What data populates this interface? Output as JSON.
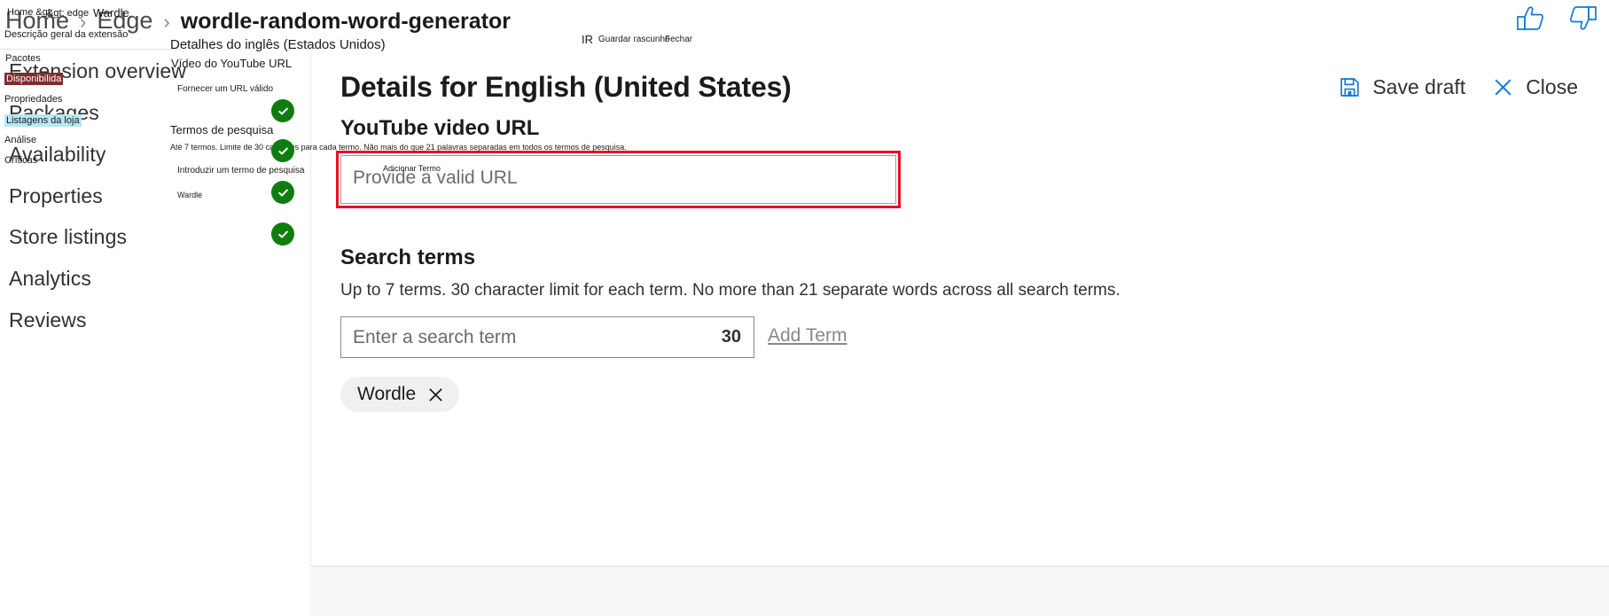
{
  "breadcrumb": {
    "items": [
      {
        "label": "Home",
        "kind": "link"
      },
      {
        "label": "Edge",
        "kind": "link"
      },
      {
        "label": "wordle-random-word-generator",
        "kind": "current"
      }
    ],
    "separator": "›",
    "overlay": [
      {
        "text": "Home &gt;"
      },
      {
        "text": "&gt; edge"
      },
      {
        "text": "Wardle"
      }
    ]
  },
  "topicons": {
    "thumbs_up": "thumbs-up-icon",
    "thumbs_down": "thumbs-down-icon"
  },
  "sidebar": {
    "items": [
      {
        "label": "Extension overview",
        "overlay": "Pacotes"
      },
      {
        "label": "Packages",
        "overlay": "Propriedades"
      },
      {
        "label": "Availability",
        "overlay": "Análise"
      },
      {
        "label": "Properties",
        "overlay": ""
      },
      {
        "label": "Store listings",
        "overlay": ""
      },
      {
        "label": "Analytics",
        "overlay": ""
      },
      {
        "label": "Reviews",
        "overlay": ""
      }
    ],
    "overlay_extra": [
      {
        "text": "Descrição geral da extensão"
      },
      {
        "text": "Disponibilidа",
        "style": "hl-red"
      },
      {
        "text": "Listagens da loja",
        "style": "hl-cyan"
      },
      {
        "text": "Críticas"
      }
    ]
  },
  "panel": {
    "title": "Details for English (United States)",
    "title_overlay": "Detalhes do inglês (Estados Unidos)",
    "actions": [
      {
        "label": "Save draft",
        "icon": "save-icon",
        "overlay": "Guardar rascunho"
      },
      {
        "label": "Close",
        "icon": "close-icon",
        "overlay": "Fechar"
      }
    ],
    "go_overlay": "IR",
    "youtube": {
      "heading": "YouTube video URL",
      "heading_overlay": "Vídeo do YouTube  URL",
      "placeholder": "Provide a valid URL",
      "placeholder_overlay": "Fornecer um URL válido",
      "value": "",
      "field_label_overlay": "Adicionar Termo",
      "invalid": true
    },
    "search_terms": {
      "heading": "Search terms",
      "heading_overlay": "Termos de pesquisa",
      "description": "Up to 7 terms. 30 character limit for each term. No more than 21 separate words across all search terms.",
      "description_overlay": "Até 7 termos.  Limite de 30 carateres para cada termo. Não mais do que 21 palavras separadas em todos os termos de pesquisa.",
      "input_placeholder": "Enter a search term",
      "input_placeholder_overlay": "Introduzir um termo de pesquisa",
      "input_value": "",
      "char_counter": "30",
      "add_button": "Add Term",
      "chips": [
        {
          "label": "Wordle",
          "overlay": "Wardle"
        }
      ]
    }
  },
  "colors": {
    "accent": "#0078d4",
    "error": "#e81123",
    "success": "#107c10",
    "text": "#1b1b1b",
    "muted": "#6b6b6b"
  }
}
